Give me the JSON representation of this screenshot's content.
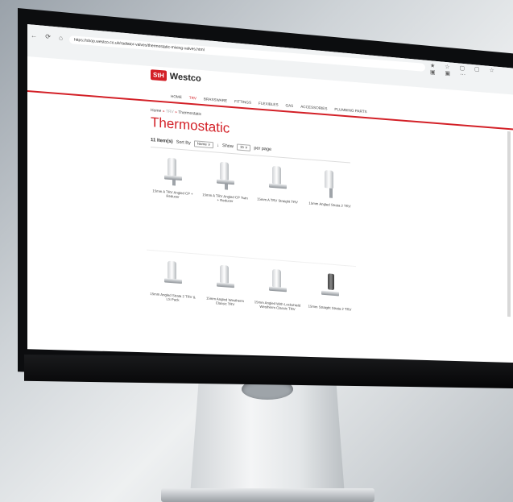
{
  "browser": {
    "url": "https://shop.westco.co.uk/radiator-valves/thermostatic-mixing-valves.html",
    "nav_icons": "← ⟳ ⌂",
    "ext_icons": "★ ☆ ▢ ▢ ☆ ▣ ▣ ⋯"
  },
  "logo": {
    "mark": "StH",
    "text": "Westco"
  },
  "menu": [
    "HOME",
    "TRV",
    "BRASSWARE",
    "FITTINGS",
    "FLEXIBLES",
    "GAS",
    "ACCESSORIES",
    "PLUMBING PARTS"
  ],
  "breadcrumb": {
    "home": "Home",
    "sep1": "»",
    "trv": "TRV",
    "sep2": "»",
    "current": "Thermostatic"
  },
  "page_title": "Thermostatic",
  "toolbar": {
    "count": "11 Item(s)",
    "sort_label": "Sort By",
    "sort_value": "Name ∨",
    "sort_dir": "↓",
    "show_label": "Show",
    "show_value": "15 ∨",
    "per_page": "per page"
  },
  "products_row1": [
    "15mm A TRV Angled CP + Reducer",
    "15mm A TRV Angled CP Twin + Reducer",
    "15mm A TRV Straight TRV",
    "15mm Angled Strata 2 TRV"
  ],
  "products_row2": [
    "15mm Angled Strata 2 TRV & LS Pack",
    "15mm Angled Westherm Classic TRV",
    "15mm Angled With Lockshield Westherm Classic TRV",
    "15mm Straight Strata 2 TRV"
  ]
}
